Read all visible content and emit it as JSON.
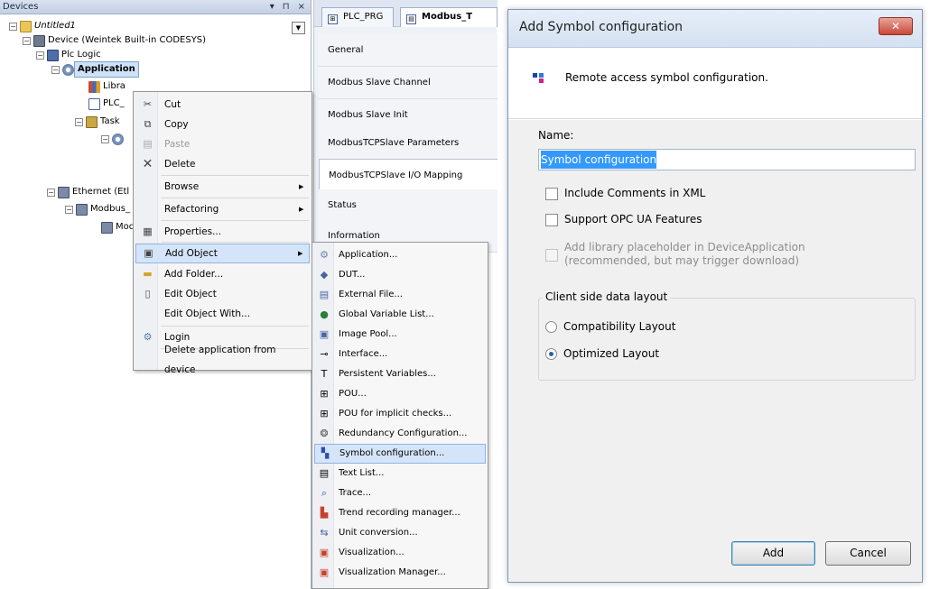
{
  "devices_panel": {
    "title": "Devices",
    "controls": [
      "▾",
      "⊓",
      "×"
    ],
    "tree": [
      {
        "label": "Untitled1",
        "icon": "project-icon"
      },
      {
        "label": "Device (Weintek Built-in CODESYS)",
        "icon": "device-icon"
      },
      {
        "label": "Plc Logic",
        "icon": "plc-logic-icon"
      },
      {
        "label": "Application",
        "icon": "application-icon"
      },
      {
        "label": "Libra",
        "icon": "library-icon"
      },
      {
        "label": "PLC_",
        "icon": "pou-icon"
      },
      {
        "label": "Task",
        "icon": "task-icon"
      },
      {
        "label": "Ethernet (Etl",
        "icon": "ethernet-icon"
      },
      {
        "label": "Modbus_",
        "icon": "modbus-icon"
      },
      {
        "label": "Mod",
        "icon": "modbus-slave-icon"
      }
    ]
  },
  "context_menu": {
    "items": [
      {
        "label": "Cut",
        "icon": "cut-icon"
      },
      {
        "label": "Copy",
        "icon": "copy-icon"
      },
      {
        "label": "Paste",
        "icon": "paste-icon",
        "disabled": true
      },
      {
        "label": "Delete",
        "icon": "delete-icon"
      },
      {
        "label": "Browse",
        "submenu": true
      },
      {
        "label": "Refactoring",
        "submenu": true
      },
      {
        "label": "Properties...",
        "icon": "properties-icon"
      },
      {
        "label": "Add Object",
        "icon": "add-object-icon",
        "submenu": true,
        "highlighted": true
      },
      {
        "label": "Add Folder...",
        "icon": "folder-icon"
      },
      {
        "label": "Edit Object",
        "icon": "edit-object-icon"
      },
      {
        "label": "Edit Object With..."
      },
      {
        "label": "Login",
        "icon": "login-icon"
      },
      {
        "label": "Delete application from device"
      }
    ]
  },
  "add_object_submenu": {
    "items": [
      {
        "label": "Application...",
        "icon": "application-icon"
      },
      {
        "label": "DUT...",
        "icon": "dut-icon"
      },
      {
        "label": "External File...",
        "icon": "external-file-icon"
      },
      {
        "label": "Global Variable List...",
        "icon": "global-variable-list-icon"
      },
      {
        "label": "Image Pool...",
        "icon": "image-pool-icon"
      },
      {
        "label": "Interface...",
        "icon": "interface-icon"
      },
      {
        "label": "Persistent Variables...",
        "icon": "persistent-variables-icon"
      },
      {
        "label": "POU...",
        "icon": "pou-icon"
      },
      {
        "label": "POU for implicit checks...",
        "icon": "pou-checks-icon"
      },
      {
        "label": "Redundancy Configuration...",
        "icon": "redundancy-icon"
      },
      {
        "label": "Symbol configuration...",
        "icon": "symbol-configuration-icon",
        "highlighted": true
      },
      {
        "label": "Text List...",
        "icon": "text-list-icon"
      },
      {
        "label": "Trace...",
        "icon": "trace-icon"
      },
      {
        "label": "Trend recording manager...",
        "icon": "trend-icon"
      },
      {
        "label": "Unit conversion...",
        "icon": "unit-conversion-icon"
      },
      {
        "label": "Visualization...",
        "icon": "visualization-icon"
      },
      {
        "label": "Visualization Manager...",
        "icon": "visualization-manager-icon"
      }
    ]
  },
  "editor": {
    "tabs": [
      {
        "label": "PLC_PRG"
      },
      {
        "label": "Modbus_T",
        "active": true
      }
    ],
    "nav": [
      {
        "label": "General"
      },
      {
        "label": "Modbus Slave Channel"
      },
      {
        "label": "Modbus Slave Init"
      },
      {
        "label": "ModbusTCPSlave Parameters"
      },
      {
        "label": "ModbusTCPSlave I/O Mapping",
        "active": true
      },
      {
        "label": "Status"
      },
      {
        "label": "Information"
      }
    ]
  },
  "dialog": {
    "title": "Add Symbol configuration",
    "close_label": "✕",
    "header_text": "Remote access symbol configuration.",
    "name_label": "Name:",
    "name_value": "Symbol configuration",
    "include_comments": {
      "label": "Include Comments in XML",
      "checked": false
    },
    "support_opc": {
      "label": "Support OPC UA Features",
      "checked": false
    },
    "add_library": {
      "line1": "Add library placeholder in DeviceApplication",
      "line2": "(recommended, but may trigger download)",
      "disabled": true,
      "checked": false
    },
    "layout_group": {
      "legend": "Client side data layout",
      "options": [
        {
          "label": "Compatibility Layout",
          "selected": false
        },
        {
          "label": "Optimized Layout",
          "selected": true
        }
      ]
    },
    "add_button": "Add",
    "cancel_button": "Cancel"
  }
}
